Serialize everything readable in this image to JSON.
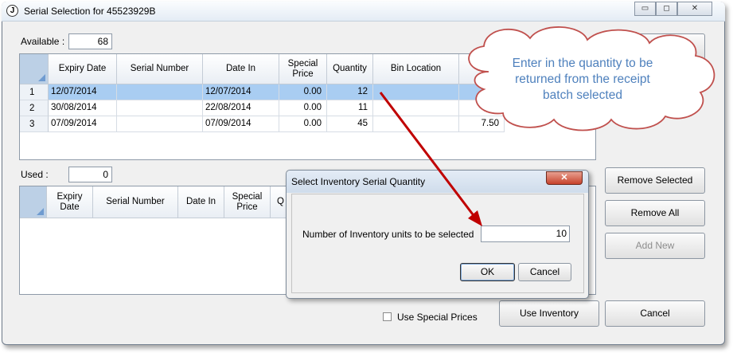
{
  "window": {
    "title": "Serial Selection for 45523929B",
    "app_icon_glyph": "J",
    "controls": {
      "minimize": "▭",
      "restore": "◻",
      "close": "✕"
    }
  },
  "available": {
    "label": "Available :",
    "value": "68"
  },
  "used": {
    "label": "Used :",
    "value": "0"
  },
  "top_grid": {
    "headers": [
      "Expiry Date",
      "Serial Number",
      "Date In",
      "Special Price",
      "Quantity",
      "Bin Location"
    ],
    "rows": [
      {
        "n": "1",
        "expiry": "12/07/2014",
        "serial": "",
        "date_in": "12/07/2014",
        "price": "0.00",
        "qty": "12",
        "bin": "",
        "extra": ""
      },
      {
        "n": "2",
        "expiry": "30/08/2014",
        "serial": "",
        "date_in": "22/08/2014",
        "price": "0.00",
        "qty": "11",
        "bin": "",
        "extra": ""
      },
      {
        "n": "3",
        "expiry": "07/09/2014",
        "serial": "",
        "date_in": "07/09/2014",
        "price": "0.00",
        "qty": "45",
        "bin": "",
        "extra": "7.50"
      }
    ]
  },
  "bottom_grid": {
    "headers": [
      "Expiry Date",
      "Serial Number",
      "Date In",
      "Special Price",
      "Q"
    ]
  },
  "buttons": {
    "remove_selected": "Remove Selected",
    "remove_all": "Remove All",
    "add_new": "Add New",
    "use_inventory": "Use Inventory",
    "cancel": "Cancel"
  },
  "special_prices_label": "Use Special Prices",
  "dialog": {
    "title": "Select Inventory Serial Quantity",
    "close": "✕",
    "prompt": "Number of Inventory units to be selected",
    "value": "10",
    "ok": "OK",
    "cancel": "Cancel"
  },
  "callout": {
    "lines": [
      "Enter in the quantity to be",
      "returned from the receipt",
      "batch selected"
    ],
    "text_color": "#4f81bd",
    "border_color": "#c0504d"
  },
  "colors": {
    "selection": "#a9cdf2",
    "arrow": "#c00000"
  }
}
